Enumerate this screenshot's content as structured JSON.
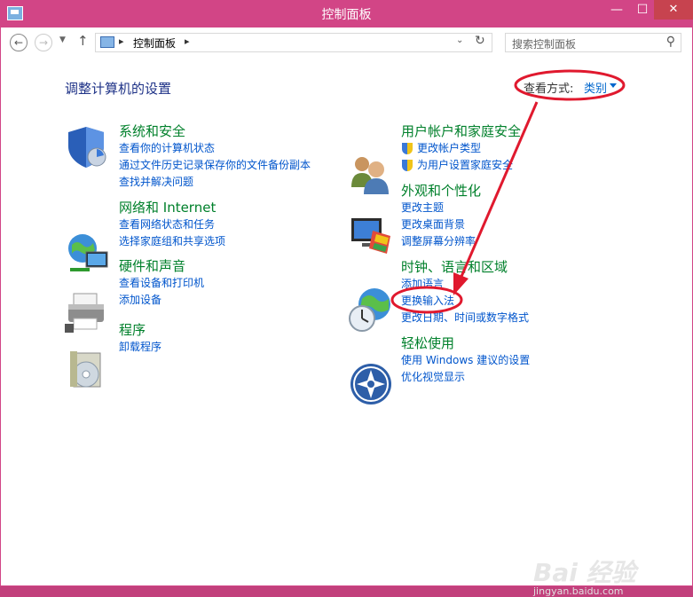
{
  "window": {
    "title": "控制面板",
    "min_glyph": "—",
    "max_glyph": "☐",
    "close_glyph": "✕"
  },
  "nav": {
    "back_glyph": "←",
    "forward_glyph": "→",
    "recent_glyph": "▼",
    "up_glyph": "↑",
    "address": {
      "crumb": "控制面板",
      "sep": "▸",
      "dropdown_glyph": "⌄",
      "refresh_glyph": "↻"
    },
    "search": {
      "placeholder": "搜索控制面板",
      "icon_glyph": "⚲"
    }
  },
  "page": {
    "heading": "调整计算机的设置",
    "view_by_label": "查看方式:",
    "view_by_value": "类别"
  },
  "categories": [
    {
      "title": "系统和安全",
      "icon": "shield-icon",
      "links": [
        "查看你的计算机状态",
        "通过文件历史记录保存你的文件备份副本",
        "查找并解决问题"
      ]
    },
    {
      "title": "网络和 Internet",
      "icon": "network-globe-icon",
      "links": [
        "查看网络状态和任务",
        "选择家庭组和共享选项"
      ]
    },
    {
      "title": "硬件和声音",
      "icon": "printer-icon",
      "links": [
        "查看设备和打印机",
        "添加设备"
      ]
    },
    {
      "title": "程序",
      "icon": "programs-disc-icon",
      "links": [
        "卸载程序"
      ]
    },
    {
      "title": "用户帐户和家庭安全",
      "icon": "users-icon",
      "links": [
        "更改帐户类型",
        "为用户设置家庭安全"
      ]
    },
    {
      "title": "外观和个性化",
      "icon": "monitor-palette-icon",
      "links": [
        "更改主题",
        "更改桌面背景",
        "调整屏幕分辨率"
      ]
    },
    {
      "title": "时钟、语言和区域",
      "icon": "clock-globe-icon",
      "links": [
        "添加语言",
        "更换输入法",
        "更改日期、时间或数字格式"
      ]
    },
    {
      "title": "轻松使用",
      "icon": "ease-of-access-icon",
      "links": [
        "使用 Windows 建议的设置",
        "优化视觉显示"
      ]
    }
  ],
  "annotation_color": "#e0192e",
  "watermark": {
    "brand": "Bai 经验",
    "url": "jingyan.baidu.com"
  }
}
